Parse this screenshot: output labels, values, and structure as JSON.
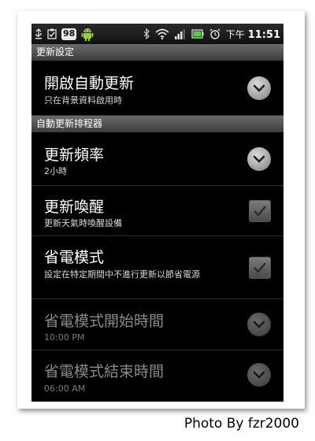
{
  "status_bar": {
    "battery_level": "98",
    "time_prefix": "下午",
    "time": "11:51",
    "icons": [
      "usb-icon",
      "clipboard-check-icon",
      "android-icon",
      "bluetooth-icon",
      "wifi-icon",
      "signal-icon",
      "battery-icon",
      "alarm-icon"
    ]
  },
  "screen": {
    "section_top": "更新設定",
    "auto_update": {
      "title": "開啟自動更新",
      "subtitle": "只在背景資料啟用時"
    },
    "section_scheduler": "自動更新排程器",
    "frequency": {
      "title": "更新頻率",
      "subtitle": "2小時"
    },
    "wake_update": {
      "title": "更新喚醒",
      "subtitle": "更新天氣時喚醒設備",
      "checked": true
    },
    "power_save": {
      "title": "省電模式",
      "subtitle": "設定在特定期間中不進行更新以節省電源",
      "checked": true
    },
    "power_save_start": {
      "title": "省電模式開始時間",
      "subtitle": "10:00 PM"
    },
    "power_save_end": {
      "title": "省電模式結束時間",
      "subtitle": "06:00 AM"
    }
  },
  "photo_credit": "Photo By fzr2000",
  "colors": {
    "screen_bg": "#000000",
    "section_header": "#555555",
    "text_primary": "#ffffff",
    "text_disabled": "#8a8a8a"
  }
}
